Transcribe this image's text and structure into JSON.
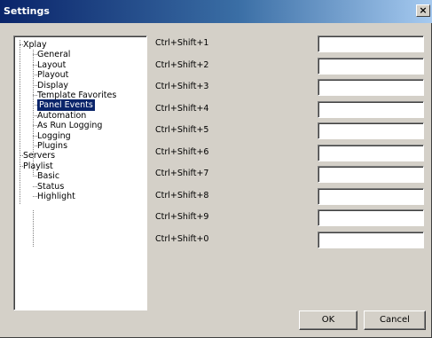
{
  "window": {
    "title": "Settings",
    "close_glyph": "×"
  },
  "tree": [
    {
      "label": "Xplay",
      "level": 0
    },
    {
      "label": "General",
      "level": 1
    },
    {
      "label": "Layout",
      "level": 1
    },
    {
      "label": "Playout",
      "level": 1
    },
    {
      "label": "Display",
      "level": 1
    },
    {
      "label": "Template Favorites",
      "level": 1
    },
    {
      "label": "Panel Events",
      "level": 1,
      "selected": true
    },
    {
      "label": "Automation",
      "level": 1
    },
    {
      "label": "As Run Logging",
      "level": 1
    },
    {
      "label": "Logging",
      "level": 1
    },
    {
      "label": "Plugins",
      "level": 1
    },
    {
      "label": "Servers",
      "level": 0
    },
    {
      "label": "Playlist",
      "level": 0
    },
    {
      "label": "Basic",
      "level": 1
    },
    {
      "label": "Status",
      "level": 1
    },
    {
      "label": "Highlight",
      "level": 1
    }
  ],
  "shortcuts": [
    {
      "label": "Ctrl+Shift+1",
      "value": ""
    },
    {
      "label": "Ctrl+Shift+2",
      "value": ""
    },
    {
      "label": "Ctrl+Shift+3",
      "value": ""
    },
    {
      "label": "Ctrl+Shift+4",
      "value": ""
    },
    {
      "label": "Ctrl+Shift+5",
      "value": ""
    },
    {
      "label": "Ctrl+Shift+6",
      "value": ""
    },
    {
      "label": "Ctrl+Shift+7",
      "value": ""
    },
    {
      "label": "Ctrl+Shift+8",
      "value": ""
    },
    {
      "label": "Ctrl+Shift+9",
      "value": ""
    },
    {
      "label": "Ctrl+Shift+0",
      "value": ""
    }
  ],
  "buttons": {
    "ok": "OK",
    "cancel": "Cancel"
  }
}
